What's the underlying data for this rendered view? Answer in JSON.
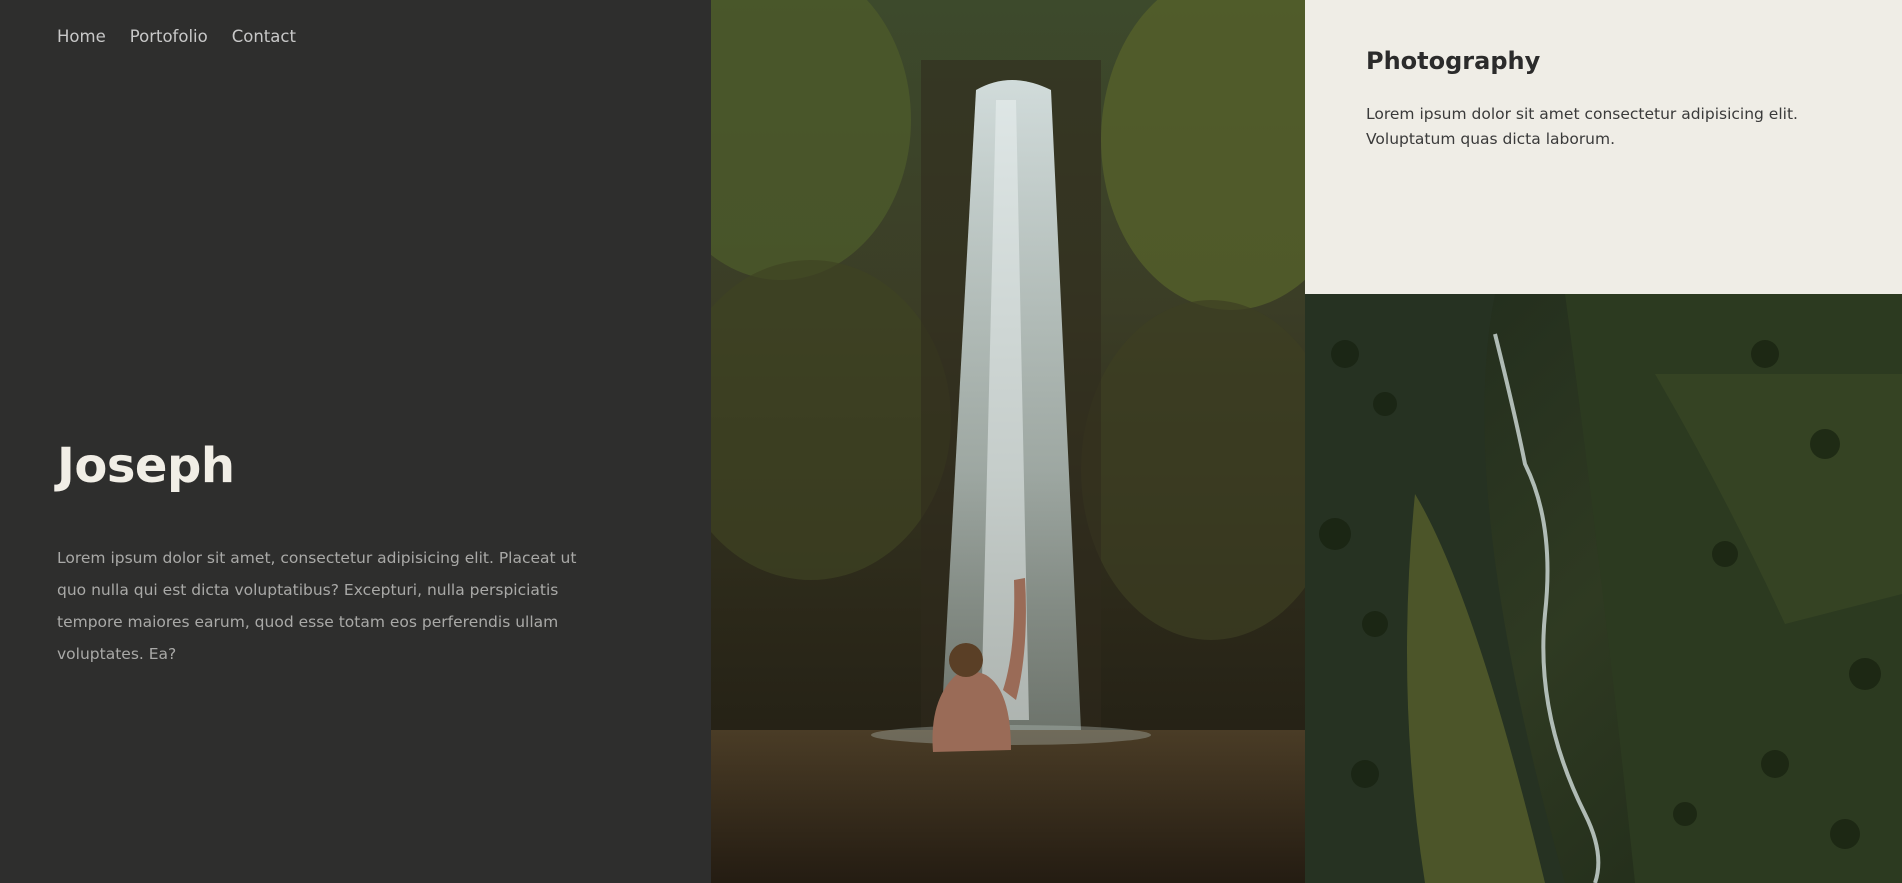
{
  "nav": {
    "items": [
      {
        "label": "Home"
      },
      {
        "label": "Portofolio"
      },
      {
        "label": "Contact"
      }
    ]
  },
  "hero": {
    "name": "Joseph",
    "text": "Lorem ipsum dolor sit amet, consectetur adipisicing elit. Placeat ut quo nulla qui est dicta voluptatibus? Excepturi, nulla perspiciatis tempore maiores earum, quod esse totam eos perferendis ullam voluptates. Ea?"
  },
  "card": {
    "title": "Photography",
    "text": "Lorem ipsum dolor sit amet consectetur adipisicing elit. Voluptatum quas dicta laborum."
  },
  "colors": {
    "dark_panel": "#2e2e2d",
    "card_background": "#efede6",
    "heading_light": "#f1eee6"
  }
}
